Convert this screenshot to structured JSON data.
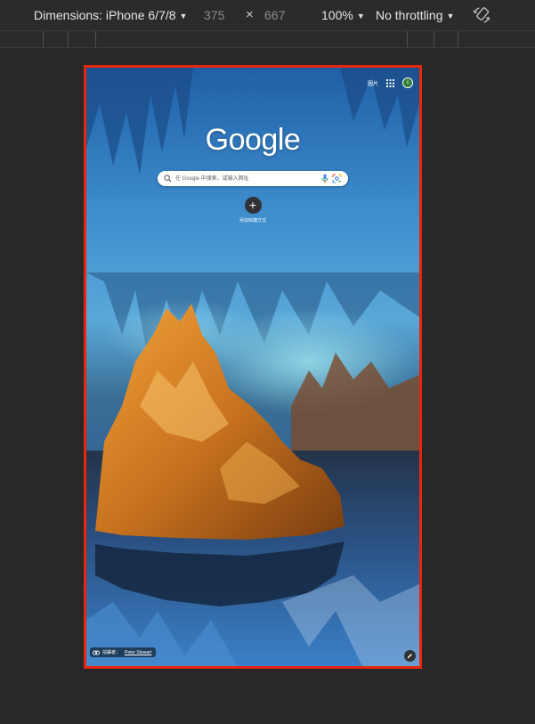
{
  "devtools": {
    "device_label": "Dimensions: iPhone 6/7/8",
    "width": "375",
    "times_symbol": "×",
    "height": "667",
    "zoom": "100%",
    "throttling": "No throttling",
    "icons": {
      "rotate": "rotate-icon",
      "caret": "chevron-down-icon"
    }
  },
  "ntp": {
    "top_links": {
      "images_label": "圖片"
    },
    "avatar_letter": "c",
    "logo_text": "Google",
    "search": {
      "placeholder": "在 Google 中搜索，或输入网址"
    },
    "shortcut": {
      "plus": "+",
      "label": "添加快捷方式"
    },
    "attribution": {
      "prefix": "拍攝者：",
      "author": "Peter Stewart"
    },
    "icons": {
      "apps": "apps-grid-icon",
      "search": "search-icon",
      "mic": "microphone-icon",
      "lens": "lens-icon",
      "link": "link-icon",
      "customize": "pencil-icon"
    }
  },
  "colors": {
    "device_outline": "#e8260c",
    "devtools_bg": "#282828",
    "avatar_bg": "#2e7d32"
  }
}
